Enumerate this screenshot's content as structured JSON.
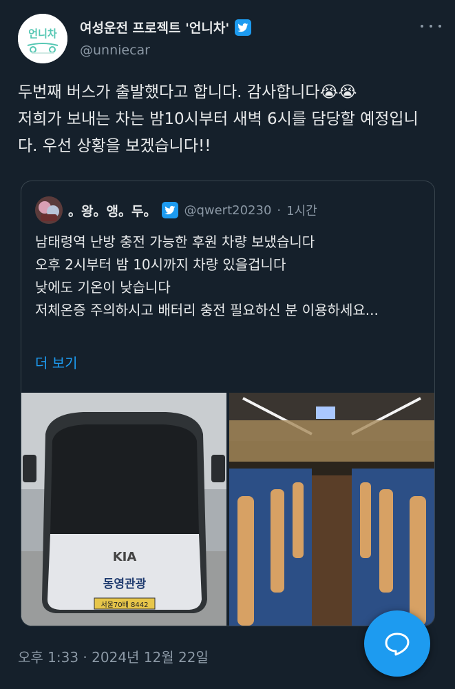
{
  "author": {
    "display_name": "여성운전 프로젝트 '언니차'",
    "handle": "@unniecar",
    "avatar_text": "언니차"
  },
  "tweet": {
    "text": "두번째 버스가 출발했다고 합니다. 감사합니다😭😭\n저희가 보내는 차는 밤10시부터 새벽 6시를 담당할 예정입니다. 우선 상황을 보겠습니다!!"
  },
  "quote": {
    "display_name": "。왕。앵。두。",
    "handle": "@qwert20230",
    "separator": "·",
    "time_ago": "1시간",
    "text": "남태령역 난방 충전 가능한 후원 차량 보냈습니다\n오후 2시부터 밤 10시까지 차량 있을겁니다\n낮에도 기온이 낮습니다\n저체온증 주의하시고 배터리 충전 필요하신 분 이용하세요...",
    "show_more": "더 보기",
    "bus_company": "동영관광",
    "bus_brand": "KIA",
    "plate": "서울70배 8442"
  },
  "timestamp": "오후 1:33 · 2024년 12월 22일",
  "colors": {
    "background": "#15202b",
    "text": "#e7e9ea",
    "secondary": "#8b98a5",
    "accent": "#1d9bf0",
    "border": "#38444d"
  },
  "icons": {
    "verified": "verified-badge-icon",
    "more": "more-dots-icon",
    "fab": "speech-bubble-icon"
  }
}
